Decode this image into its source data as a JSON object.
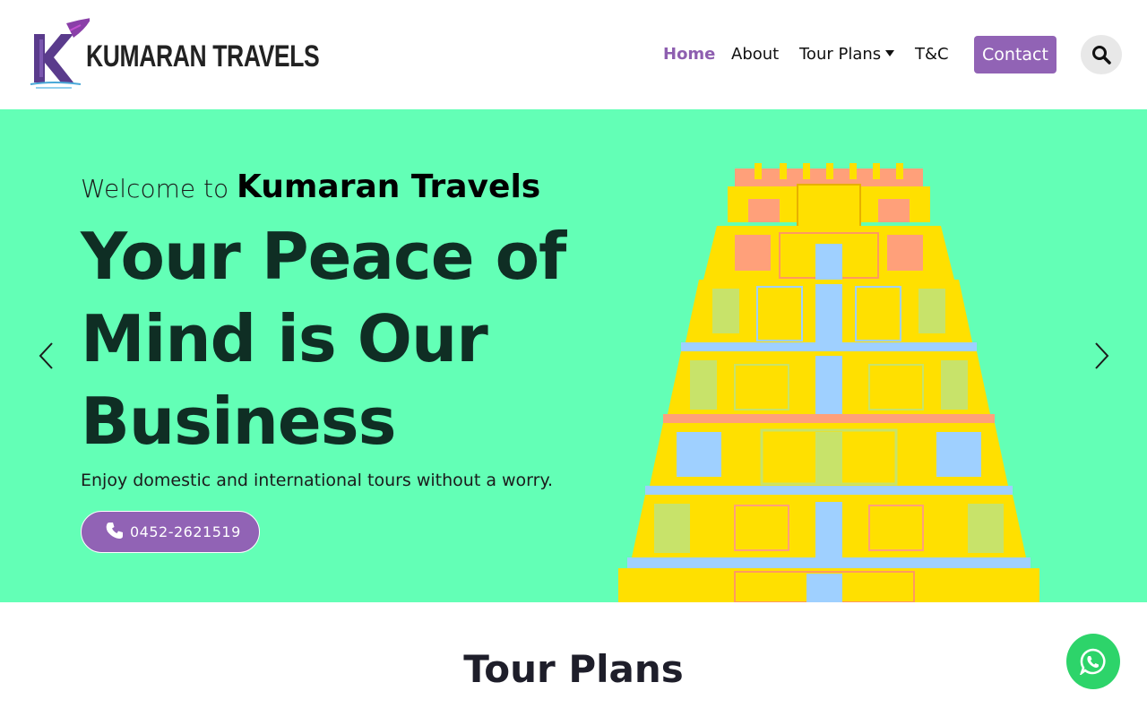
{
  "brand": {
    "name": "KUMARAN TRAVELS"
  },
  "nav": {
    "items": [
      {
        "label": "Home",
        "active": true
      },
      {
        "label": "About",
        "active": false
      },
      {
        "label": "Tour Plans",
        "active": false,
        "has_dropdown": true
      },
      {
        "label": "T&C",
        "active": false
      }
    ],
    "contact_label": "Contact",
    "search_icon": "search-icon"
  },
  "hero": {
    "welcome_prefix": "Welcome to",
    "welcome_brand": "Kumaran Travels",
    "headline": "Your Peace of Mind is Our Business",
    "subtext": "Enjoy domestic and international tours without a worry.",
    "phone": "0452-2621519",
    "phone_icon": "phone-icon",
    "prev_icon": "chevron-left-icon",
    "next_icon": "chevron-right-icon"
  },
  "section": {
    "title": "Tour Plans"
  },
  "floating": {
    "icon": "whatsapp-icon"
  },
  "colors": {
    "accent": "#9163b5",
    "hero_bg": "#63ffb6",
    "headline": "#0f2e24",
    "whatsapp": "#2dd46a"
  }
}
